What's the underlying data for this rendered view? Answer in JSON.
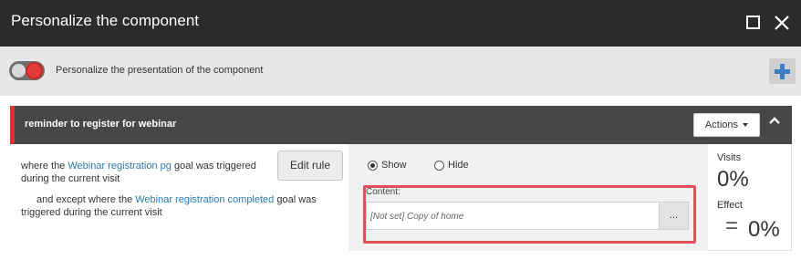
{
  "window": {
    "title": "Personalize the component",
    "maximize_icon": "maximize-icon",
    "close_icon": "close-icon"
  },
  "toolbar": {
    "toggle_state": "off",
    "label": "Personalize the presentation of the component",
    "add_icon": "plus-icon",
    "accent": "#3a7fc2"
  },
  "rule": {
    "name": "reminder to register for webinar",
    "actions_label": "Actions",
    "conditions": [
      {
        "prefix": "where the ",
        "goal": "Webinar registration pg",
        "suffix": " goal was triggered during the current visit"
      },
      {
        "prefix": "and except where the ",
        "goal": "Webinar registration completed",
        "suffix": " goal was triggered during the current visit"
      }
    ],
    "edit_rule_label": "Edit rule",
    "visibility": {
      "show_label": "Show",
      "hide_label": "Hide",
      "selected": "Show"
    },
    "content_label": "Content:",
    "content_value": "[Not set] Copy of home",
    "browse_label": "...",
    "stats": {
      "visits_label": "Visits",
      "visits_value": "0%",
      "effect_label": "Effect",
      "effect_symbol": "=",
      "effect_value": "0%"
    }
  },
  "colors": {
    "titlebar": "#2b2b2b",
    "rule_header": "#474747",
    "rule_marker": "#e0302f",
    "highlight": "#e15057",
    "link": "#2a7ab0"
  }
}
